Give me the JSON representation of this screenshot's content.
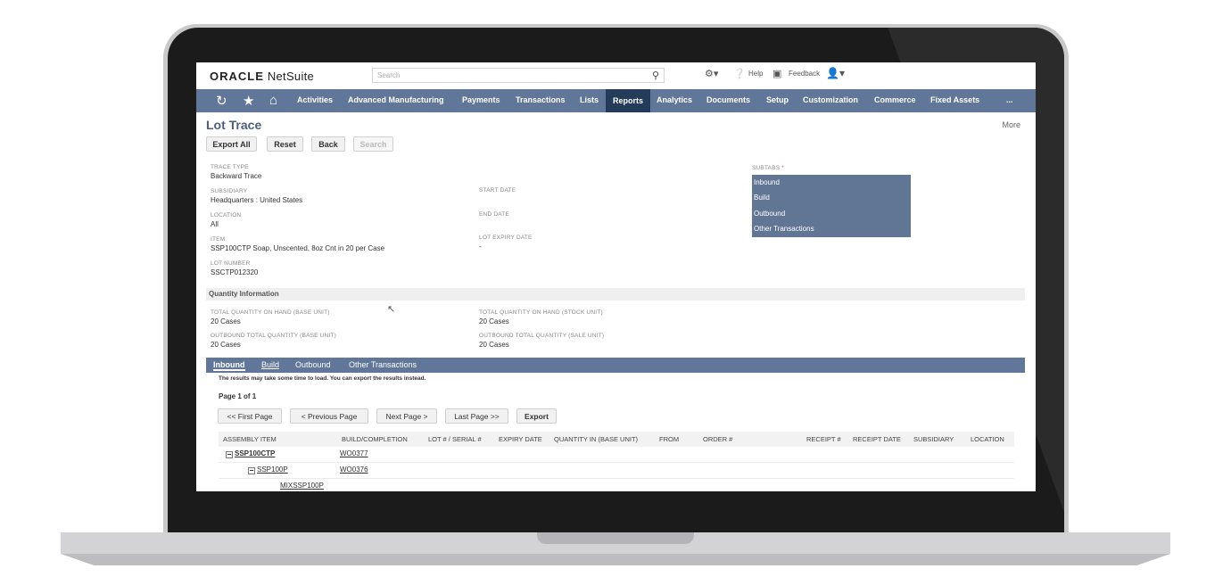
{
  "topbar": {
    "logo_brand": "ORACLE",
    "logo_product": "NetSuite",
    "search_placeholder": "Search",
    "help_label": "Help",
    "feedback_label": "Feedback"
  },
  "nav": {
    "items": [
      "Activities",
      "Advanced Manufacturing",
      "Payments",
      "Transactions",
      "Lists",
      "Reports",
      "Analytics",
      "Documents",
      "Setup",
      "Customization",
      "Commerce",
      "Fixed Assets",
      "..."
    ],
    "active": "Reports"
  },
  "page": {
    "title": "Lot Trace",
    "more_label": "More",
    "buttons": [
      "Export All",
      "Reset",
      "Back",
      "Search"
    ]
  },
  "form": {
    "trace_type_label": "TRACE TYPE",
    "trace_type": "Backward Trace",
    "subsidiary_label": "SUBSIDIARY",
    "subsidiary": "Headquarters : United States",
    "location_label": "LOCATION",
    "location": "All",
    "item_label": "ITEM",
    "item": "SSP100CTP Soap, Unscented, 8oz Cnt in 20 per Case",
    "lot_number_label": "LOT NUMBER",
    "lot_number": "SSCTP012320",
    "start_date_label": "START DATE",
    "end_date_label": "END DATE",
    "lot_expiry_label": "LOT EXPIRY DATE",
    "lot_expiry": "-",
    "subtabs_label": "SUBTABS",
    "subtabs_required": "*",
    "subtabs": [
      "Inbound",
      "Build",
      "Outbound",
      "Other Transactions"
    ]
  },
  "quantity": {
    "section_title": "Quantity Information",
    "total_base_label": "TOTAL QUANTITY ON HAND (BASE UNIT)",
    "total_base": "20 Cases",
    "total_stock_label": "TOTAL QUANTITY ON HAND (STOCK UNIT)",
    "total_stock": "20 Cases",
    "outbound_base_label": "OUTBOUND TOTAL QUANTITY (BASE UNIT)",
    "outbound_base": "20 Cases",
    "outbound_sale_label": "OUTBOUND TOTAL QUANTITY (SALE UNIT)",
    "outbound_sale": "20 Cases"
  },
  "results": {
    "tabs": [
      "Inbound",
      "Build",
      "Outbound",
      "Other Transactions"
    ],
    "active_tab": "Inbound",
    "note": "The results may take some time to load. You can export the results instead.",
    "page_info": "Page 1 of 1",
    "pager": [
      "<< First Page",
      "< Previous Page",
      "Next Page >",
      "Last Page >>",
      "Export"
    ],
    "columns": [
      "ASSEMBLY ITEM",
      "BUILD/COMPLETION",
      "LOT # / SERIAL #",
      "EXPIRY DATE",
      "QUANTITY IN (BASE UNIT)",
      "FROM",
      "ORDER #",
      "RECEIPT #",
      "RECEIPT DATE",
      "SUBSIDIARY",
      "LOCATION"
    ],
    "rows": [
      {
        "item": "SSP100CTP",
        "build": "WO0377"
      },
      {
        "item": "SSP100P",
        "build": "WO0376"
      },
      {
        "item": "MIXSSP100P",
        "build": ""
      }
    ]
  }
}
